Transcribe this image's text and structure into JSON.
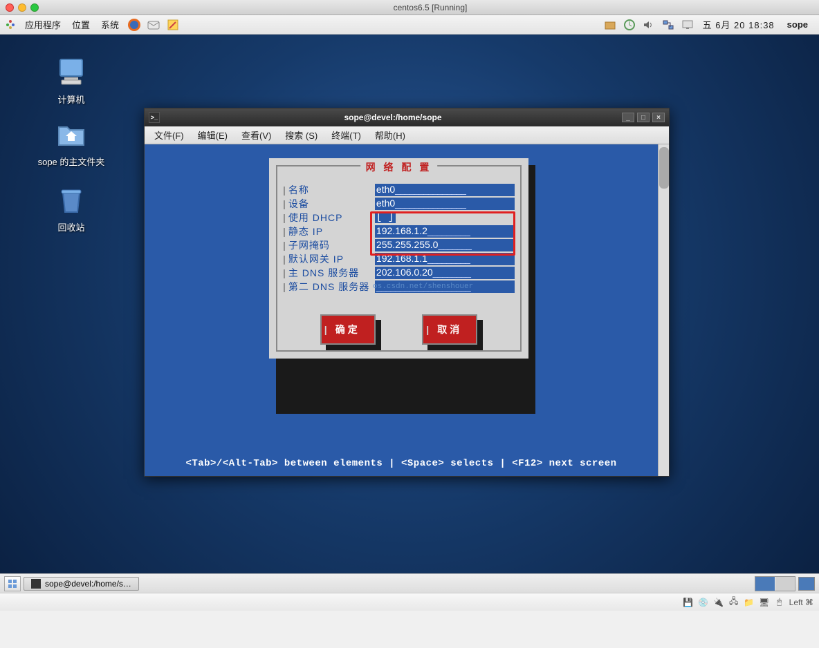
{
  "mac": {
    "title": "centos6.5 [Running]"
  },
  "panel": {
    "apps": "应用程序",
    "places": "位置",
    "system": "系统",
    "date": "五 6月 20 18:38",
    "user": "sope"
  },
  "desktop": {
    "computer": "计算机",
    "home": "sope 的主文件夹",
    "trash": "回收站"
  },
  "term": {
    "title": "sope@devel:/home/sope",
    "menus": {
      "file": "文件(F)",
      "edit": "编辑(E)",
      "view": "查看(V)",
      "search": "搜索 (S)",
      "terminal": "终端(T)",
      "help": "帮助(H)"
    },
    "footer": "<Tab>/<Alt-Tab> between elements   |   <Space> selects   |   <F12> next screen",
    "watermark": "os.csdn.net/shenshouer"
  },
  "tui": {
    "title": "网 络 配 置",
    "labels": {
      "name": "名称",
      "device": "设备",
      "dhcp": "使用 DHCP",
      "static_ip": "静态 IP",
      "netmask": "子网掩码",
      "gateway": "默认网关 IP",
      "dns1": "主 DNS 服务器",
      "dns2": "第二 DNS 服务器"
    },
    "values": {
      "name": "eth0",
      "device": "eth0",
      "dhcp": "[ ]",
      "static_ip": "192.168.1.2",
      "netmask": "255.255.255.0",
      "gateway": "192.168.1.1",
      "dns1": "202.106.0.20",
      "dns2": ""
    },
    "ok": "确定",
    "cancel": "取消"
  },
  "taskbar": {
    "item": "sope@devel:/home/s…"
  },
  "host": {
    "left": "Left ⌘"
  }
}
